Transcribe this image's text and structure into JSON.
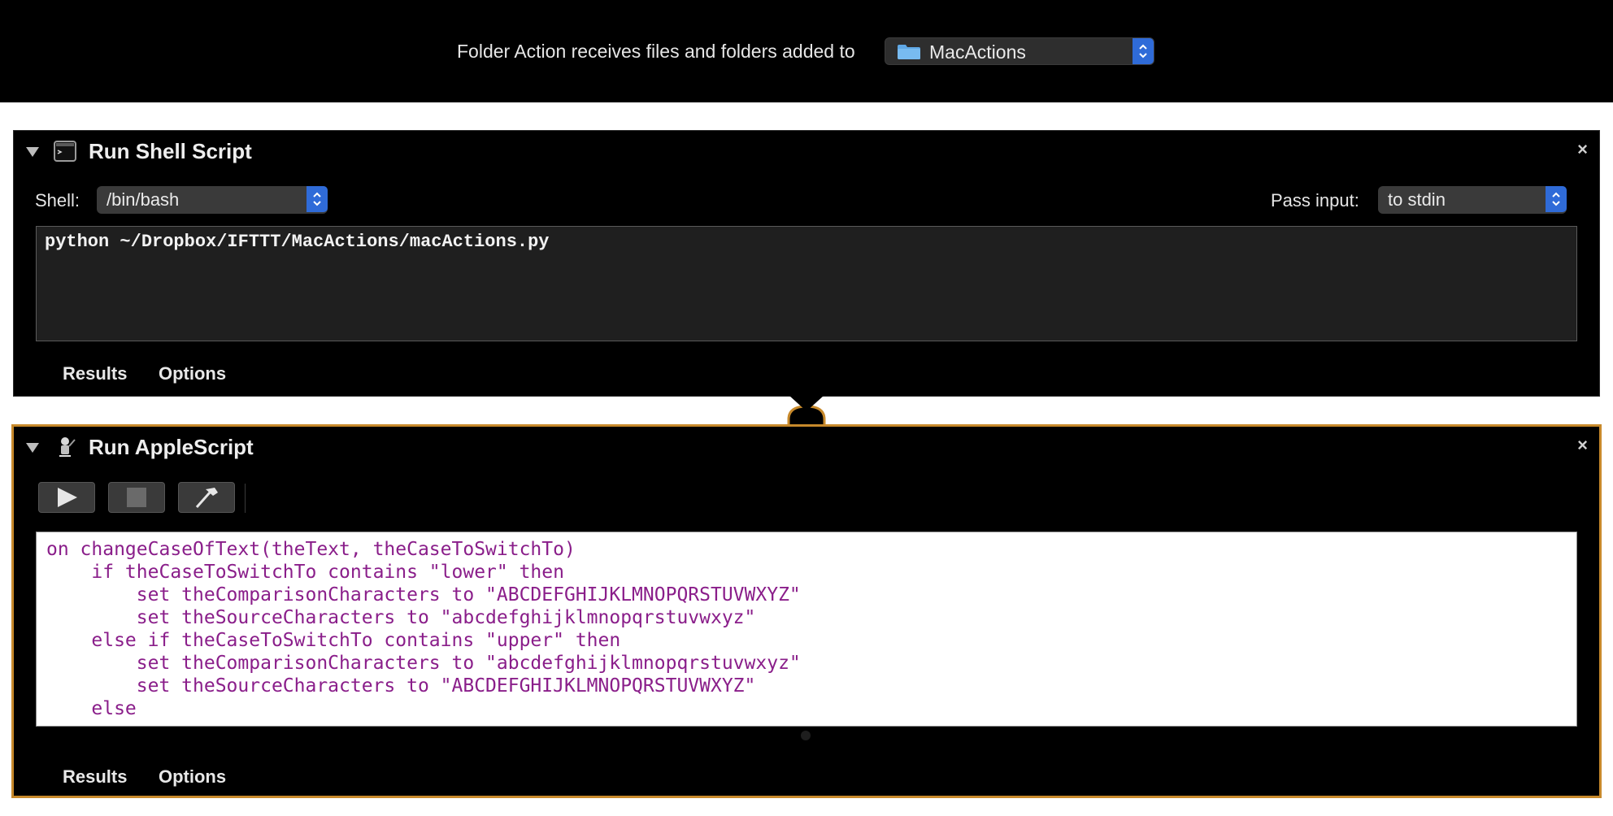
{
  "workflow": {
    "receives_label": "Folder Action receives files and folders added to",
    "folder_value": "MacActions"
  },
  "shell_action": {
    "title": "Run Shell Script",
    "shell_label": "Shell:",
    "shell_value": "/bin/bash",
    "pass_input_label": "Pass input:",
    "pass_input_value": "to stdin",
    "script": "python ~/Dropbox/IFTTT/MacActions/macActions.py",
    "tabs": {
      "results": "Results",
      "options": "Options"
    },
    "close": "×"
  },
  "applescript_action": {
    "title": "Run AppleScript",
    "script_lines": [
      "on changeCaseOfText(theText, theCaseToSwitchTo)",
      "    if theCaseToSwitchTo contains \"lower\" then",
      "        set theComparisonCharacters to \"ABCDEFGHIJKLMNOPQRSTUVWXYZ\"",
      "        set theSourceCharacters to \"abcdefghijklmnopqrstuvwxyz\"",
      "    else if theCaseToSwitchTo contains \"upper\" then",
      "        set theComparisonCharacters to \"abcdefghijklmnopqrstuvwxyz\"",
      "        set theSourceCharacters to \"ABCDEFGHIJKLMNOPQRSTUVWXYZ\"",
      "    else"
    ],
    "tabs": {
      "results": "Results",
      "options": "Options"
    },
    "close": "×"
  },
  "icons": {
    "folder": "folder-icon",
    "terminal": "terminal-icon",
    "script_editor": "script-editor-icon",
    "run": "play-icon",
    "stop": "stop-icon",
    "compile": "hammer-icon"
  },
  "colors": {
    "accent_blue": "#2f6bd8",
    "selection_border": "#c7892b",
    "applescript_text": "#8a1e8a"
  }
}
